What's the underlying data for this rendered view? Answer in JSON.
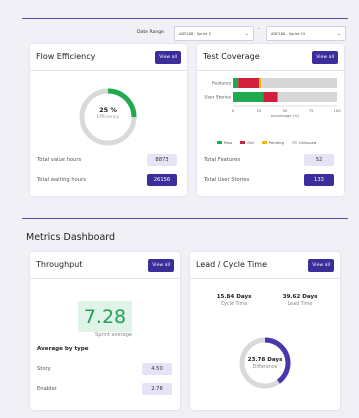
{
  "filters": {
    "label": "Date Range",
    "start": "ADF288 - Sprint 5",
    "end": "ADF288 - Sprint 19",
    "separator": "-"
  },
  "flow_efficiency": {
    "title": "Flow Efficiency",
    "button": "View all",
    "percent": "25 %",
    "percent_value": 25,
    "caption": "Efficiency",
    "stats": [
      {
        "label": "Total value hours",
        "value": "8873"
      },
      {
        "label": "Total waiting hours",
        "value": "26156"
      }
    ]
  },
  "test_coverage": {
    "title": "Test Coverage",
    "button": "View all",
    "stats": [
      {
        "label": "Total Features",
        "value": "52"
      },
      {
        "label": "Total User Stories",
        "value": "133"
      }
    ]
  },
  "chart_data": {
    "type": "bar",
    "orientation": "horizontal",
    "stacked": true,
    "categories": [
      "Features",
      "User Stories"
    ],
    "series": [
      {
        "name": "Pass",
        "color": "#1faa4f",
        "values": [
          5,
          29
        ]
      },
      {
        "name": "Fail",
        "color": "#d21f3c",
        "values": [
          20,
          14
        ]
      },
      {
        "name": "Pending",
        "color": "#f2b705",
        "values": [
          2,
          0
        ]
      },
      {
        "name": "Unissued",
        "color": "#d7d7d7",
        "values": [
          73,
          57
        ]
      }
    ],
    "xlabel": "percentage (%)",
    "xlim": [
      0,
      100
    ],
    "xticks": [
      "0",
      "25",
      "50",
      "75",
      "100"
    ],
    "legend": "bottom"
  },
  "dashboard": {
    "title": "Metrics Dashboard"
  },
  "throughput": {
    "title": "Throughput",
    "button": "View all",
    "value": "7.28",
    "caption": "Sprint average",
    "avg_title": "Average by type",
    "rows": [
      {
        "label": "Story",
        "value": "4.50"
      },
      {
        "label": "Enabler",
        "value": "2.78"
      }
    ]
  },
  "lead_cycle": {
    "title": "Lead / Cycle Time",
    "button": "View all",
    "cycle_value": "15.84 Days",
    "cycle_label": "Cycle Time",
    "lead_value": "39.62 Days",
    "lead_label": "Lead Time",
    "difference_value": "23.78 Days",
    "difference_label": "Difference",
    "ring_fraction": 0.4
  },
  "colors": {
    "accent": "#3b2d9c",
    "green": "#1faa4f",
    "ring_track": "#d9d9d9",
    "ring_purple": "#4b36b0"
  }
}
